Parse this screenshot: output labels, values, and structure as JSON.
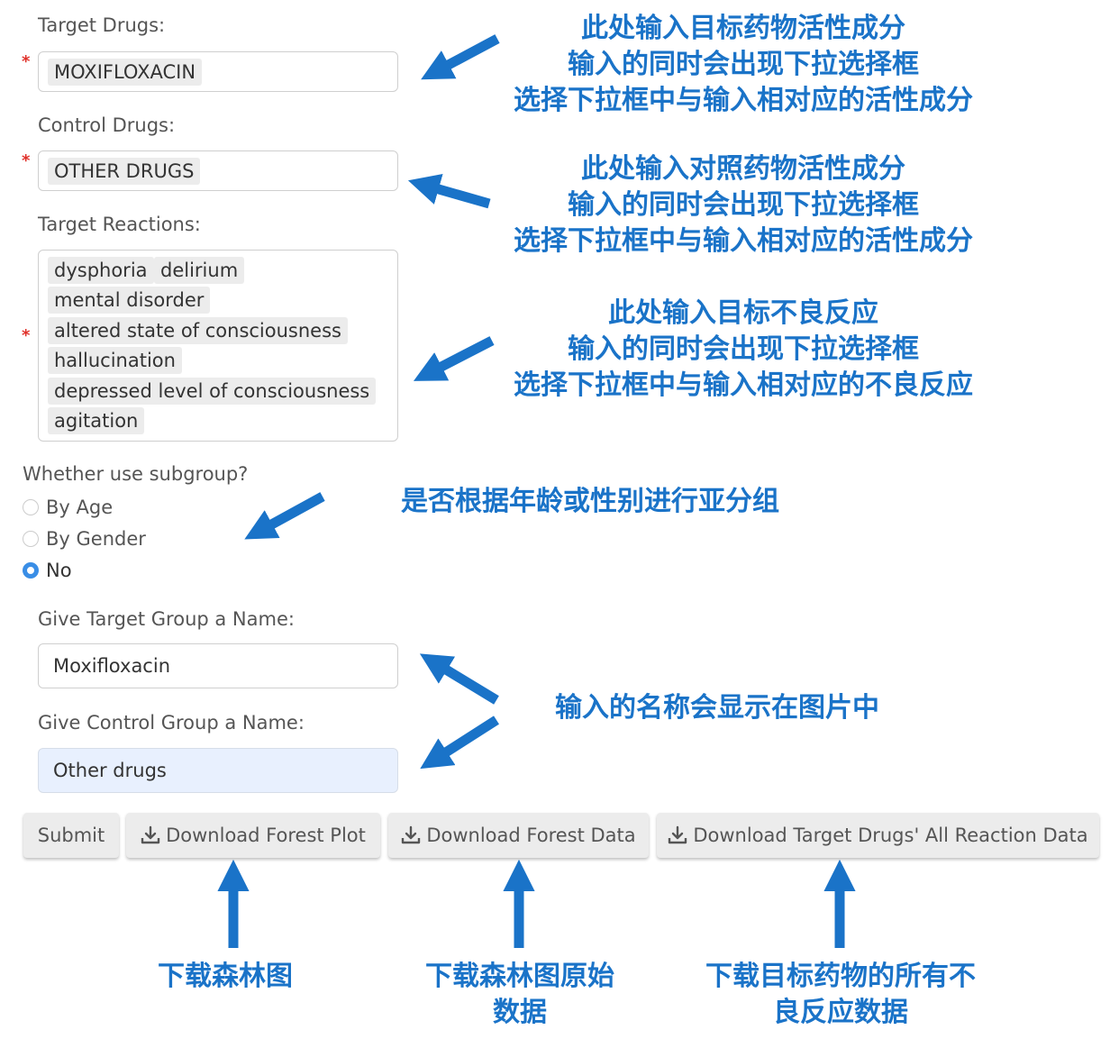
{
  "form": {
    "target_drugs_label": "Target Drugs:",
    "target_drugs_tag": "MOXIFLOXACIN",
    "control_drugs_label": "Control Drugs:",
    "control_drugs_tag": "OTHER DRUGS",
    "target_reactions_label": "Target Reactions:",
    "target_reactions": [
      "dysphoria",
      "delirium",
      "mental disorder",
      "altered state of consciousness",
      "hallucination",
      "depressed level of consciousness",
      "agitation"
    ],
    "required_mark": "*",
    "subgroup_label": "Whether use subgroup?",
    "subgroup_options": [
      "By Age",
      "By Gender",
      "No"
    ],
    "subgroup_selected": "No",
    "target_group_label": "Give Target Group a Name:",
    "target_group_value": "Moxifloxacin",
    "control_group_label": "Give Control Group a Name:",
    "control_group_value": "Other drugs"
  },
  "buttons": {
    "submit": "Submit",
    "download_forest_plot": "Download Forest Plot",
    "download_forest_data": "Download Forest Data",
    "download_all_reaction": "Download Target Drugs' All Reaction Data"
  },
  "annotations": {
    "target_drugs": [
      "此处输入目标药物活性成分",
      "输入的同时会出现下拉选择框",
      "选择下拉框中与输入相对应的活性成分"
    ],
    "control_drugs": [
      "此处输入对照药物活性成分",
      "输入的同时会出现下拉选择框",
      "选择下拉框中与输入相对应的活性成分"
    ],
    "target_reactions": [
      "此处输入目标不良反应",
      "输入的同时会出现下拉选择框",
      "选择下拉框中与输入相对应的不良反应"
    ],
    "subgroup": "是否根据年龄或性别进行亚分组",
    "group_names": "输入的名称会显示在图片中",
    "forest_plot": "下载森林图",
    "forest_data": [
      "下载森林图原始",
      "数据"
    ],
    "all_reaction": [
      "下载目标药物的所有不",
      "良反应数据"
    ]
  },
  "colors": {
    "annotation_blue": "#1a73c8",
    "required_red": "#e0312a",
    "radio_blue": "#3a8ee6",
    "focused_field": "#e8f0fe"
  }
}
